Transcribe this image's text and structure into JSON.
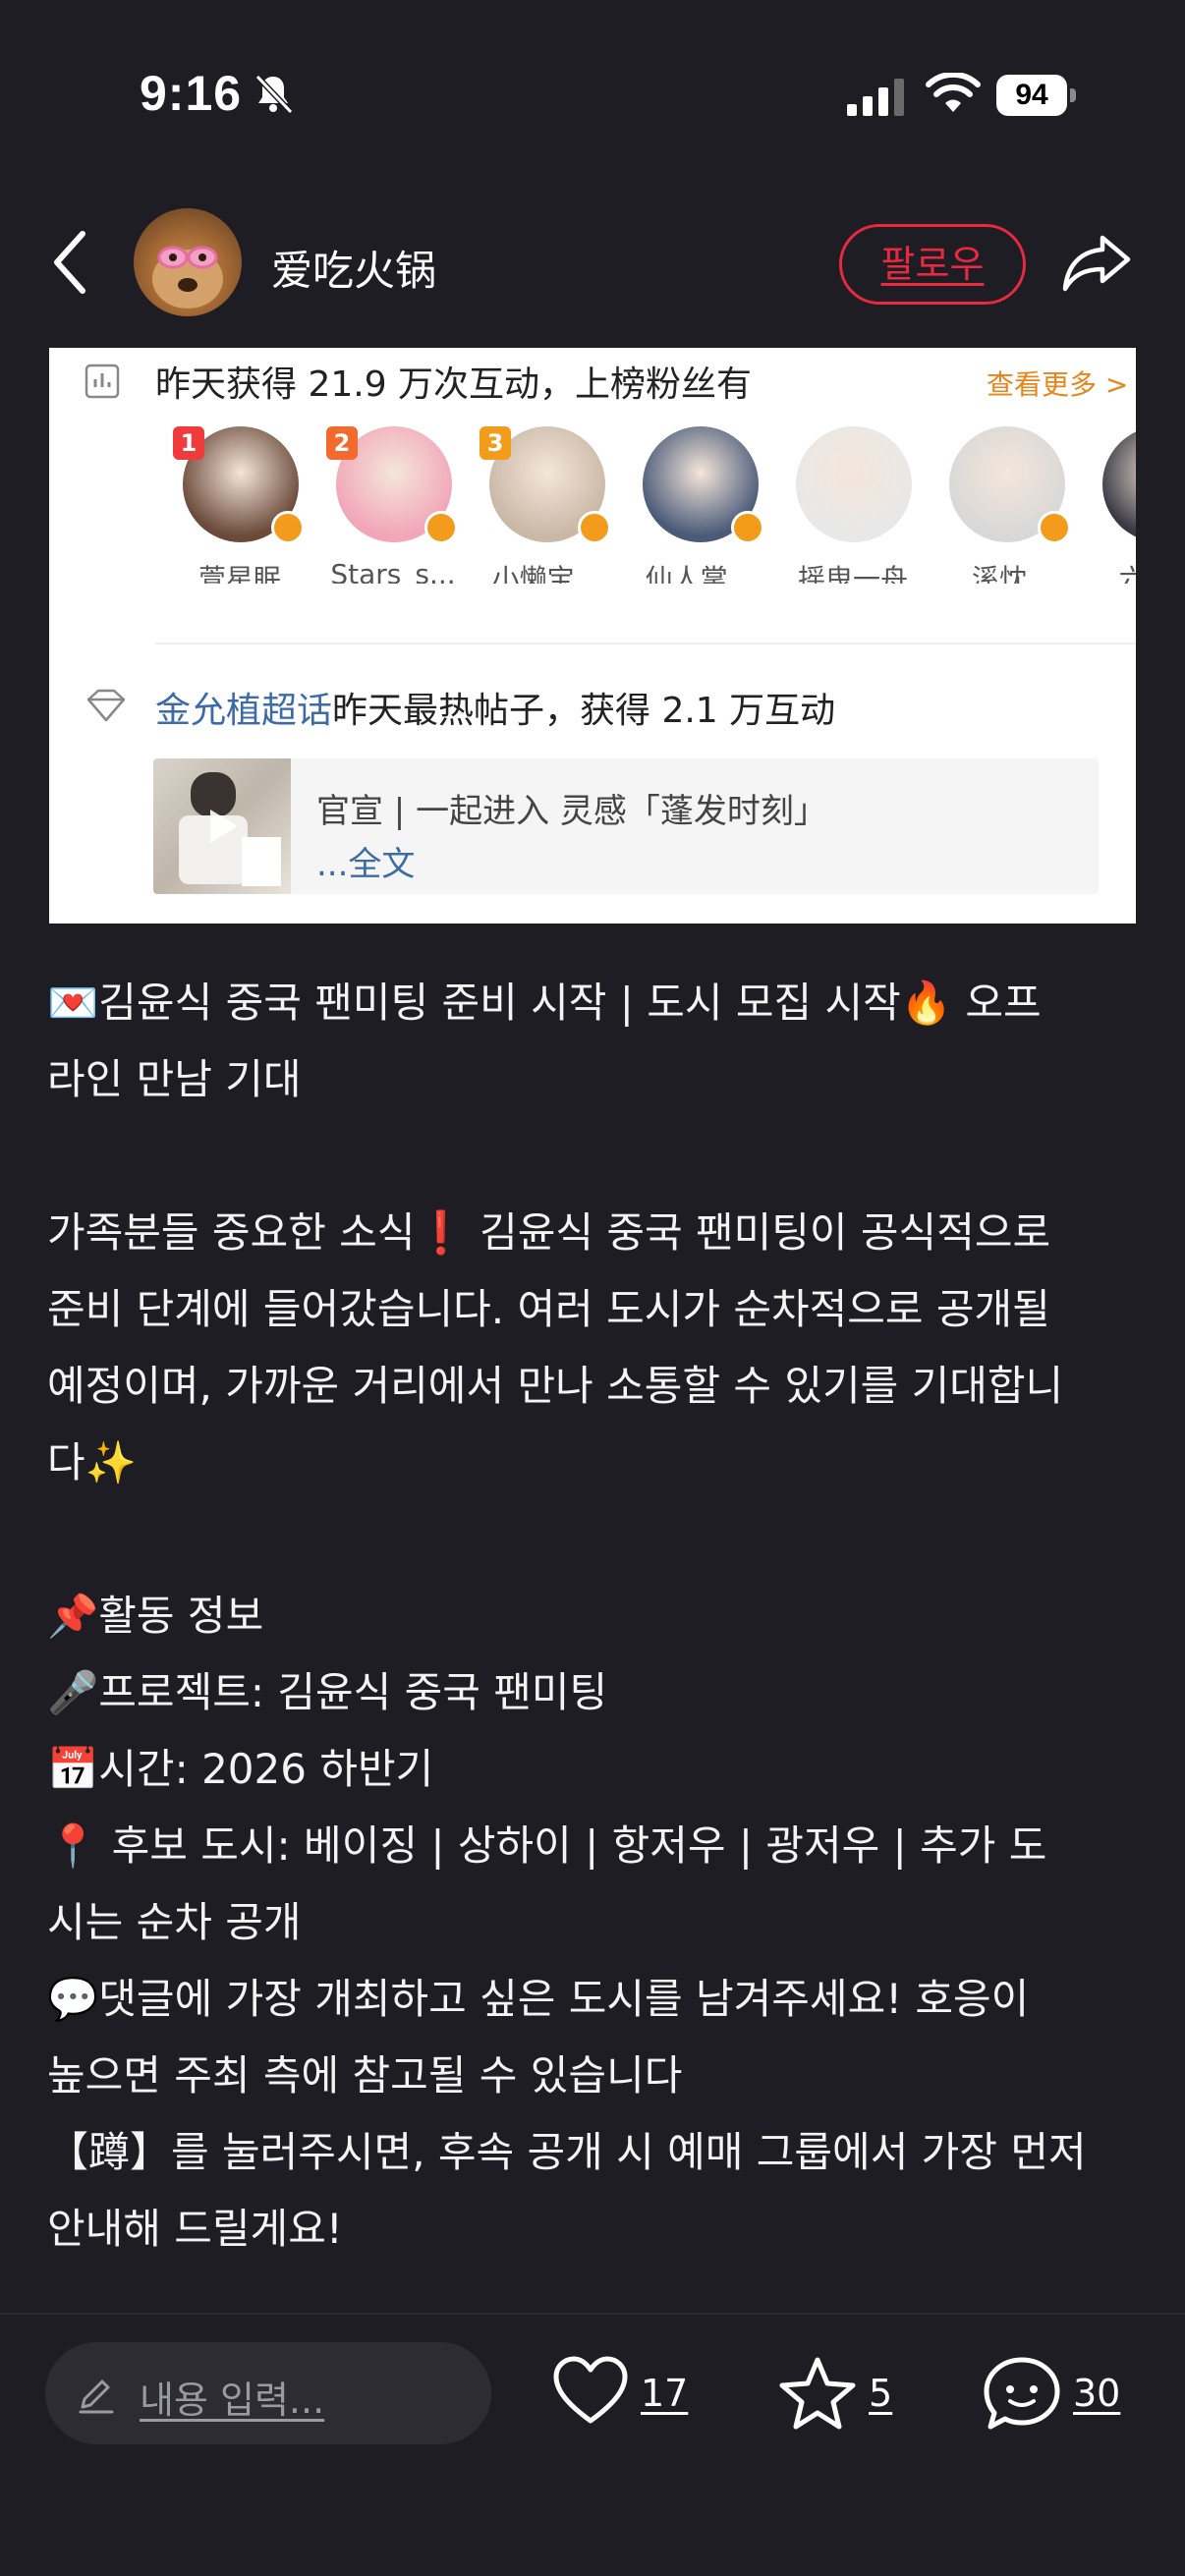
{
  "status_bar": {
    "time": "9:16",
    "battery": "94",
    "icons": [
      "bell-slash-icon",
      "signal-icon",
      "wifi-icon",
      "battery-icon"
    ]
  },
  "header": {
    "back_icon": "chevron-left-icon",
    "username": "爱吃火锅",
    "follow_label": "팔로우",
    "share_icon": "share-arrow-icon"
  },
  "card": {
    "stats_text": "昨天获得 21.9 万次互动，上榜粉丝有",
    "more_label": "查看更多 >",
    "fans": [
      {
        "rank": "1",
        "name": "萱星眠",
        "color": "#6b4a3a"
      },
      {
        "rank": "2",
        "name": "Stars_s...",
        "color": "#f2a6b8"
      },
      {
        "rank": "3",
        "name": "小懒宝...",
        "color": "#c9b8a6"
      },
      {
        "rank": "",
        "name": "仙人掌...",
        "color": "#4a5a78"
      },
      {
        "rank": "",
        "name": "摇曳一舟",
        "color": "#e8e8e8"
      },
      {
        "rank": "",
        "name": "溪忱_",
        "color": "#d8d8d8"
      },
      {
        "rank": "",
        "name": "六爻...",
        "color": "#3a3a44"
      }
    ],
    "rank_colors": [
      "#ef3b3b",
      "#f26a2e",
      "#f39b1a"
    ],
    "hot_topic": "金允植超话",
    "hot_text": "昨天最热帖子，获得 2.1 万互动",
    "post_title": "官宣 | 一起进入 灵感「蓬发时刻」",
    "post_more": "...全文"
  },
  "body": {
    "lines": [
      "💌김윤식 중국 팬미팅 준비 시작 | 도시 모집 시작🔥 오프",
      "라인 만남 기대",
      "",
      "가족분들 중요한 소식❗ 김윤식 중국 팬미팅이 공식적으로",
      "준비 단계에 들어갔습니다. 여러 도시가 순차적으로 공개될",
      "예정이며, 가까운 거리에서 만나 소통할 수 있기를 기대합니",
      "다✨",
      "",
      "📌활동 정보",
      "🎤프로젝트: 김윤식 중국 팬미팅",
      "📅시간: 2026 하반기",
      "📍 후보 도시: 베이징 | 상하이 | 항저우 | 광저우 | 추가 도",
      "시는 순차 공개",
      "💬댓글에 가장 개최하고 싶은 도시를 남겨주세요! 호응이",
      "높으면 주최 측에 참고될 수 있습니다",
      "【蹲】를 눌러주시면, 후속 공개 시 예매 그룹에서 가장 먼저",
      "안내해 드릴게요!"
    ]
  },
  "bottom_bar": {
    "comment_placeholder": "내용 입력...",
    "likes": "17",
    "favorites": "5",
    "comments": "30"
  },
  "colors": {
    "background": "#1e1d24",
    "accent_red": "#e8293f",
    "link_blue": "#3d6aa8",
    "orange": "#e8851a"
  }
}
